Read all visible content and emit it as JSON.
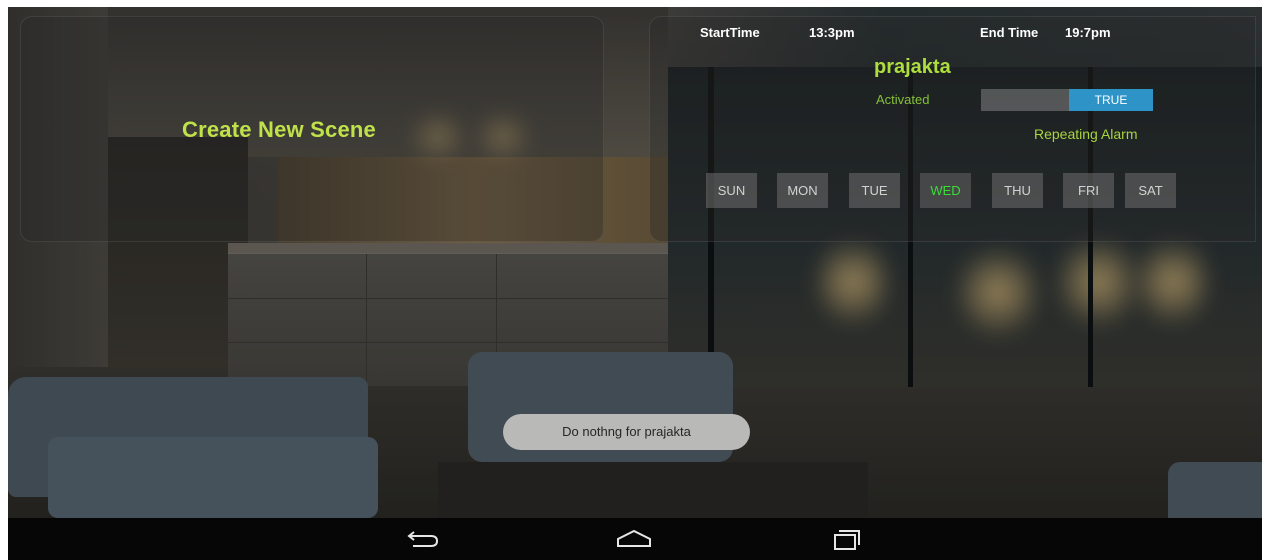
{
  "scene": {
    "title": "Create New Scene",
    "name": "prajakta",
    "start_time_label": "StartTime",
    "start_time_value": "13:3pm",
    "end_time_label": "End Time",
    "end_time_value": "19:7pm",
    "activated_label": "Activated",
    "activated_value": "TRUE",
    "repeating_label": "Repeating Alarm"
  },
  "days": [
    {
      "label": "SUN",
      "selected": false
    },
    {
      "label": "MON",
      "selected": false
    },
    {
      "label": "TUE",
      "selected": false
    },
    {
      "label": "WED",
      "selected": true
    },
    {
      "label": "THU",
      "selected": false
    },
    {
      "label": "FRI",
      "selected": false
    },
    {
      "label": "SAT",
      "selected": false
    }
  ],
  "toast": {
    "message": "Do nothng for  prajakta"
  },
  "navbar": {
    "buttons": [
      {
        "name": "back-icon"
      },
      {
        "name": "home-icon"
      },
      {
        "name": "recent-apps-icon"
      }
    ]
  },
  "colors": {
    "accent_green": "#bfe24a",
    "day_selected": "#3bdc37",
    "toggle_on": "#2e94c8",
    "toast_bg": "#b9b9b7"
  }
}
